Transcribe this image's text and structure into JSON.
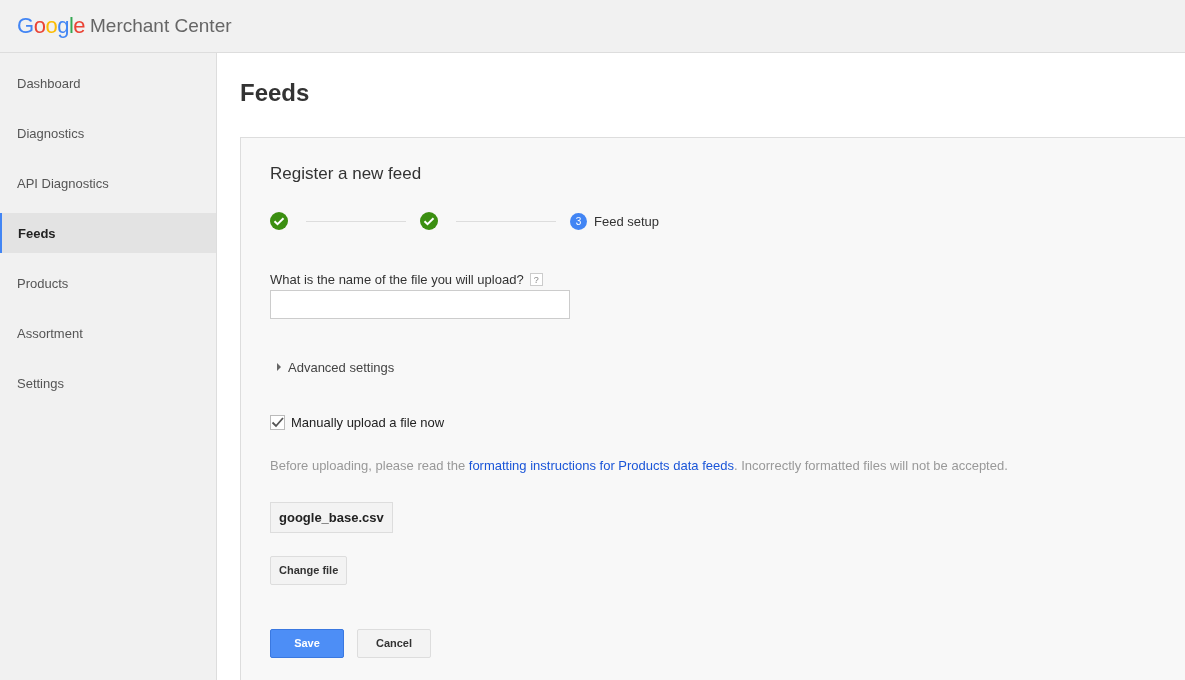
{
  "header": {
    "logo_brand": "Google",
    "logo_product": "Merchant Center"
  },
  "sidebar": {
    "items": [
      {
        "label": "Dashboard",
        "selected": false
      },
      {
        "label": "Diagnostics",
        "selected": false
      },
      {
        "label": "API Diagnostics",
        "selected": false
      },
      {
        "label": "Feeds",
        "selected": true
      },
      {
        "label": "Products",
        "selected": false
      },
      {
        "label": "Assortment",
        "selected": false
      },
      {
        "label": "Settings",
        "selected": false
      }
    ]
  },
  "page_title": "Feeds",
  "card": {
    "title": "Register a new feed",
    "steps": [
      {
        "kind": "done"
      },
      {
        "kind": "done"
      },
      {
        "kind": "current",
        "number": "3",
        "label": "Feed setup"
      }
    ],
    "file_name_field": {
      "label": "What is the name of the file you will upload?",
      "help": "?"
    },
    "advanced_settings": {
      "label": "Advanced settings",
      "expanded": false
    },
    "manual_upload": {
      "label": "Manually upload a file now",
      "checked": true
    },
    "note": {
      "before": "Before uploading, please read the ",
      "link": "formatting instructions for Products data feeds",
      "after": ". Incorrectly formatted files will not be accepted."
    },
    "file_chip": "google_base.csv",
    "change_file_button": "Change file",
    "buttons": [
      {
        "kind": "primary",
        "label": "Save"
      },
      {
        "kind": "secondary",
        "label": "Cancel"
      }
    ]
  }
}
